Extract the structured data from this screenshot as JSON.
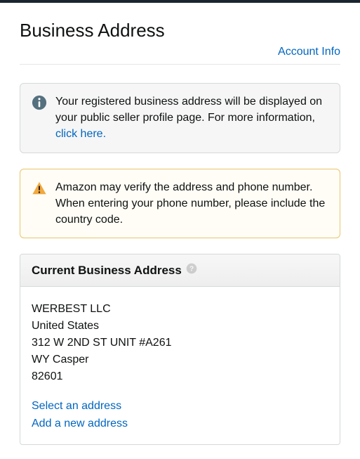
{
  "page": {
    "title": "Business Address",
    "account_info_link": "Account Info"
  },
  "alerts": {
    "info": {
      "text_before_link": "Your registered business address will be displayed on your public seller profile page. For more information, ",
      "link_text": "click here.",
      "icon": "info-icon"
    },
    "warning": {
      "text": "Amazon may verify the address and phone number. When entering your phone number, please include the country code.",
      "icon": "warning-icon"
    }
  },
  "panel": {
    "title": "Current Business Address",
    "help_icon": "help-icon",
    "address": {
      "name": "WERBEST LLC",
      "country": "United States",
      "street": "312 W 2ND ST UNIT #A261",
      "region": "WY Casper",
      "postal": "82601"
    },
    "actions": {
      "select": "Select an address",
      "add": "Add a new address"
    }
  }
}
